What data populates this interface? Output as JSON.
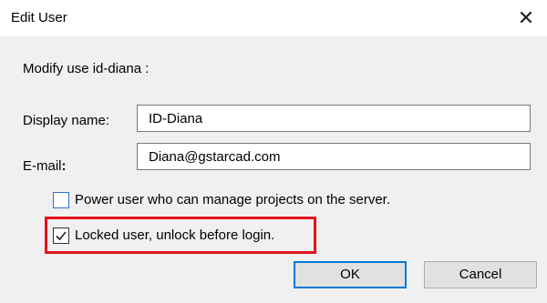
{
  "window": {
    "title": "Edit User",
    "close_glyph": "✕"
  },
  "prompt": {
    "text": "Modify use id-diana :"
  },
  "fields": {
    "display_name": {
      "label": "Display name:",
      "value": "ID-Diana"
    },
    "email": {
      "label": "E-mail",
      "label_suffix": ":",
      "value": "Diana@gstarcad.com"
    }
  },
  "options": {
    "power_user": {
      "label": "Power user who can manage projects on the server.",
      "checked": false
    },
    "locked_user": {
      "label": "Locked user, unlock before login.",
      "checked": true
    }
  },
  "buttons": {
    "ok_label": "OK",
    "cancel_label": "Cancel"
  },
  "colors": {
    "highlight": "#e4141f",
    "default_button_border": "#0078d7",
    "checkbox_border": "#2a6fd6"
  },
  "icons": {
    "close": "close-icon",
    "checkmark": "checkmark-icon"
  }
}
